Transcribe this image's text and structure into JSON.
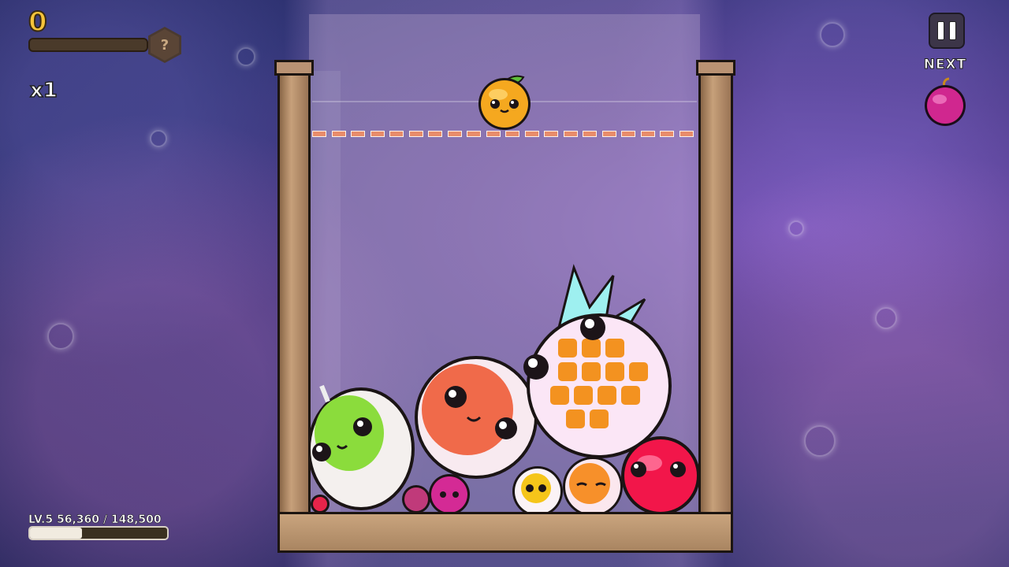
{
  "hud": {
    "score": "0",
    "rank_badge": "?",
    "multiplier": "x1",
    "pause_icon": "pause-icon",
    "next_label": "NEXT",
    "next_fruit": "plum",
    "level_text": "LV.5 56,360 / 148,500",
    "level_progress": 0.38
  },
  "game": {
    "current_fruit": "orange",
    "danger_line": "dashed-red",
    "fruits_in_jar": [
      "pear",
      "peach",
      "pineapple",
      "apple",
      "orange",
      "lemon",
      "plum",
      "grape",
      "strawberry",
      "cherry"
    ]
  },
  "colors": {
    "score": "#f6c33a",
    "danger_line": "#e88c6a",
    "wood": "#b99273"
  }
}
